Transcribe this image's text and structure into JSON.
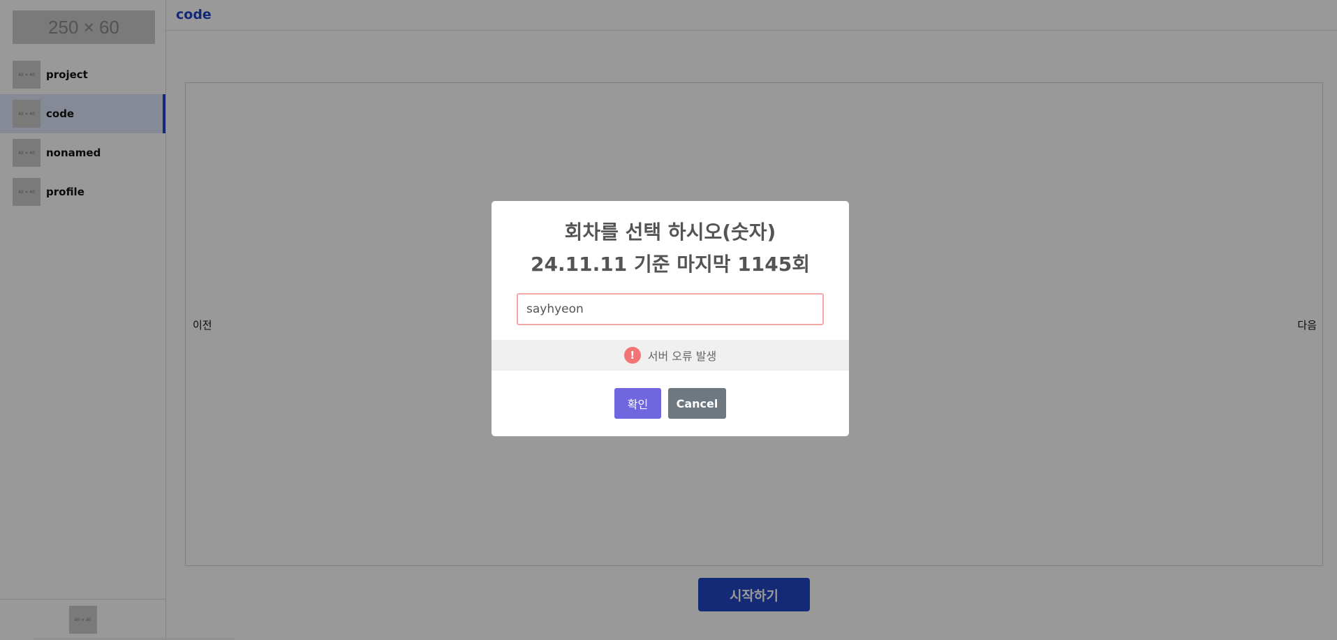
{
  "sidebar": {
    "logo_text": "250 × 60",
    "items": [
      {
        "label": "project",
        "thumb": "40 × 40",
        "active": false
      },
      {
        "label": "code",
        "thumb": "40 × 40",
        "active": true
      },
      {
        "label": "nonamed",
        "thumb": "40 × 40",
        "active": false
      },
      {
        "label": "profile",
        "thumb": "40 × 40",
        "active": false
      }
    ],
    "footer_thumb": "40 × 40"
  },
  "header": {
    "title": "code"
  },
  "board": {
    "prev_label": "이전",
    "next_label": "다음"
  },
  "start_button": "시작하기",
  "modal": {
    "title_line1": "회차를 선택 하시오(숫자)",
    "title_line2": "24.11.11 기준 마지막 1145회",
    "input_value": "sayhyeon",
    "error_icon": "!",
    "error_message": "서버 오류 발생",
    "confirm_label": "확인",
    "cancel_label": "Cancel"
  },
  "colors": {
    "accent": "#2347c6",
    "confirm": "#7066e0",
    "cancel": "#6e7881",
    "error": "#f27474"
  }
}
